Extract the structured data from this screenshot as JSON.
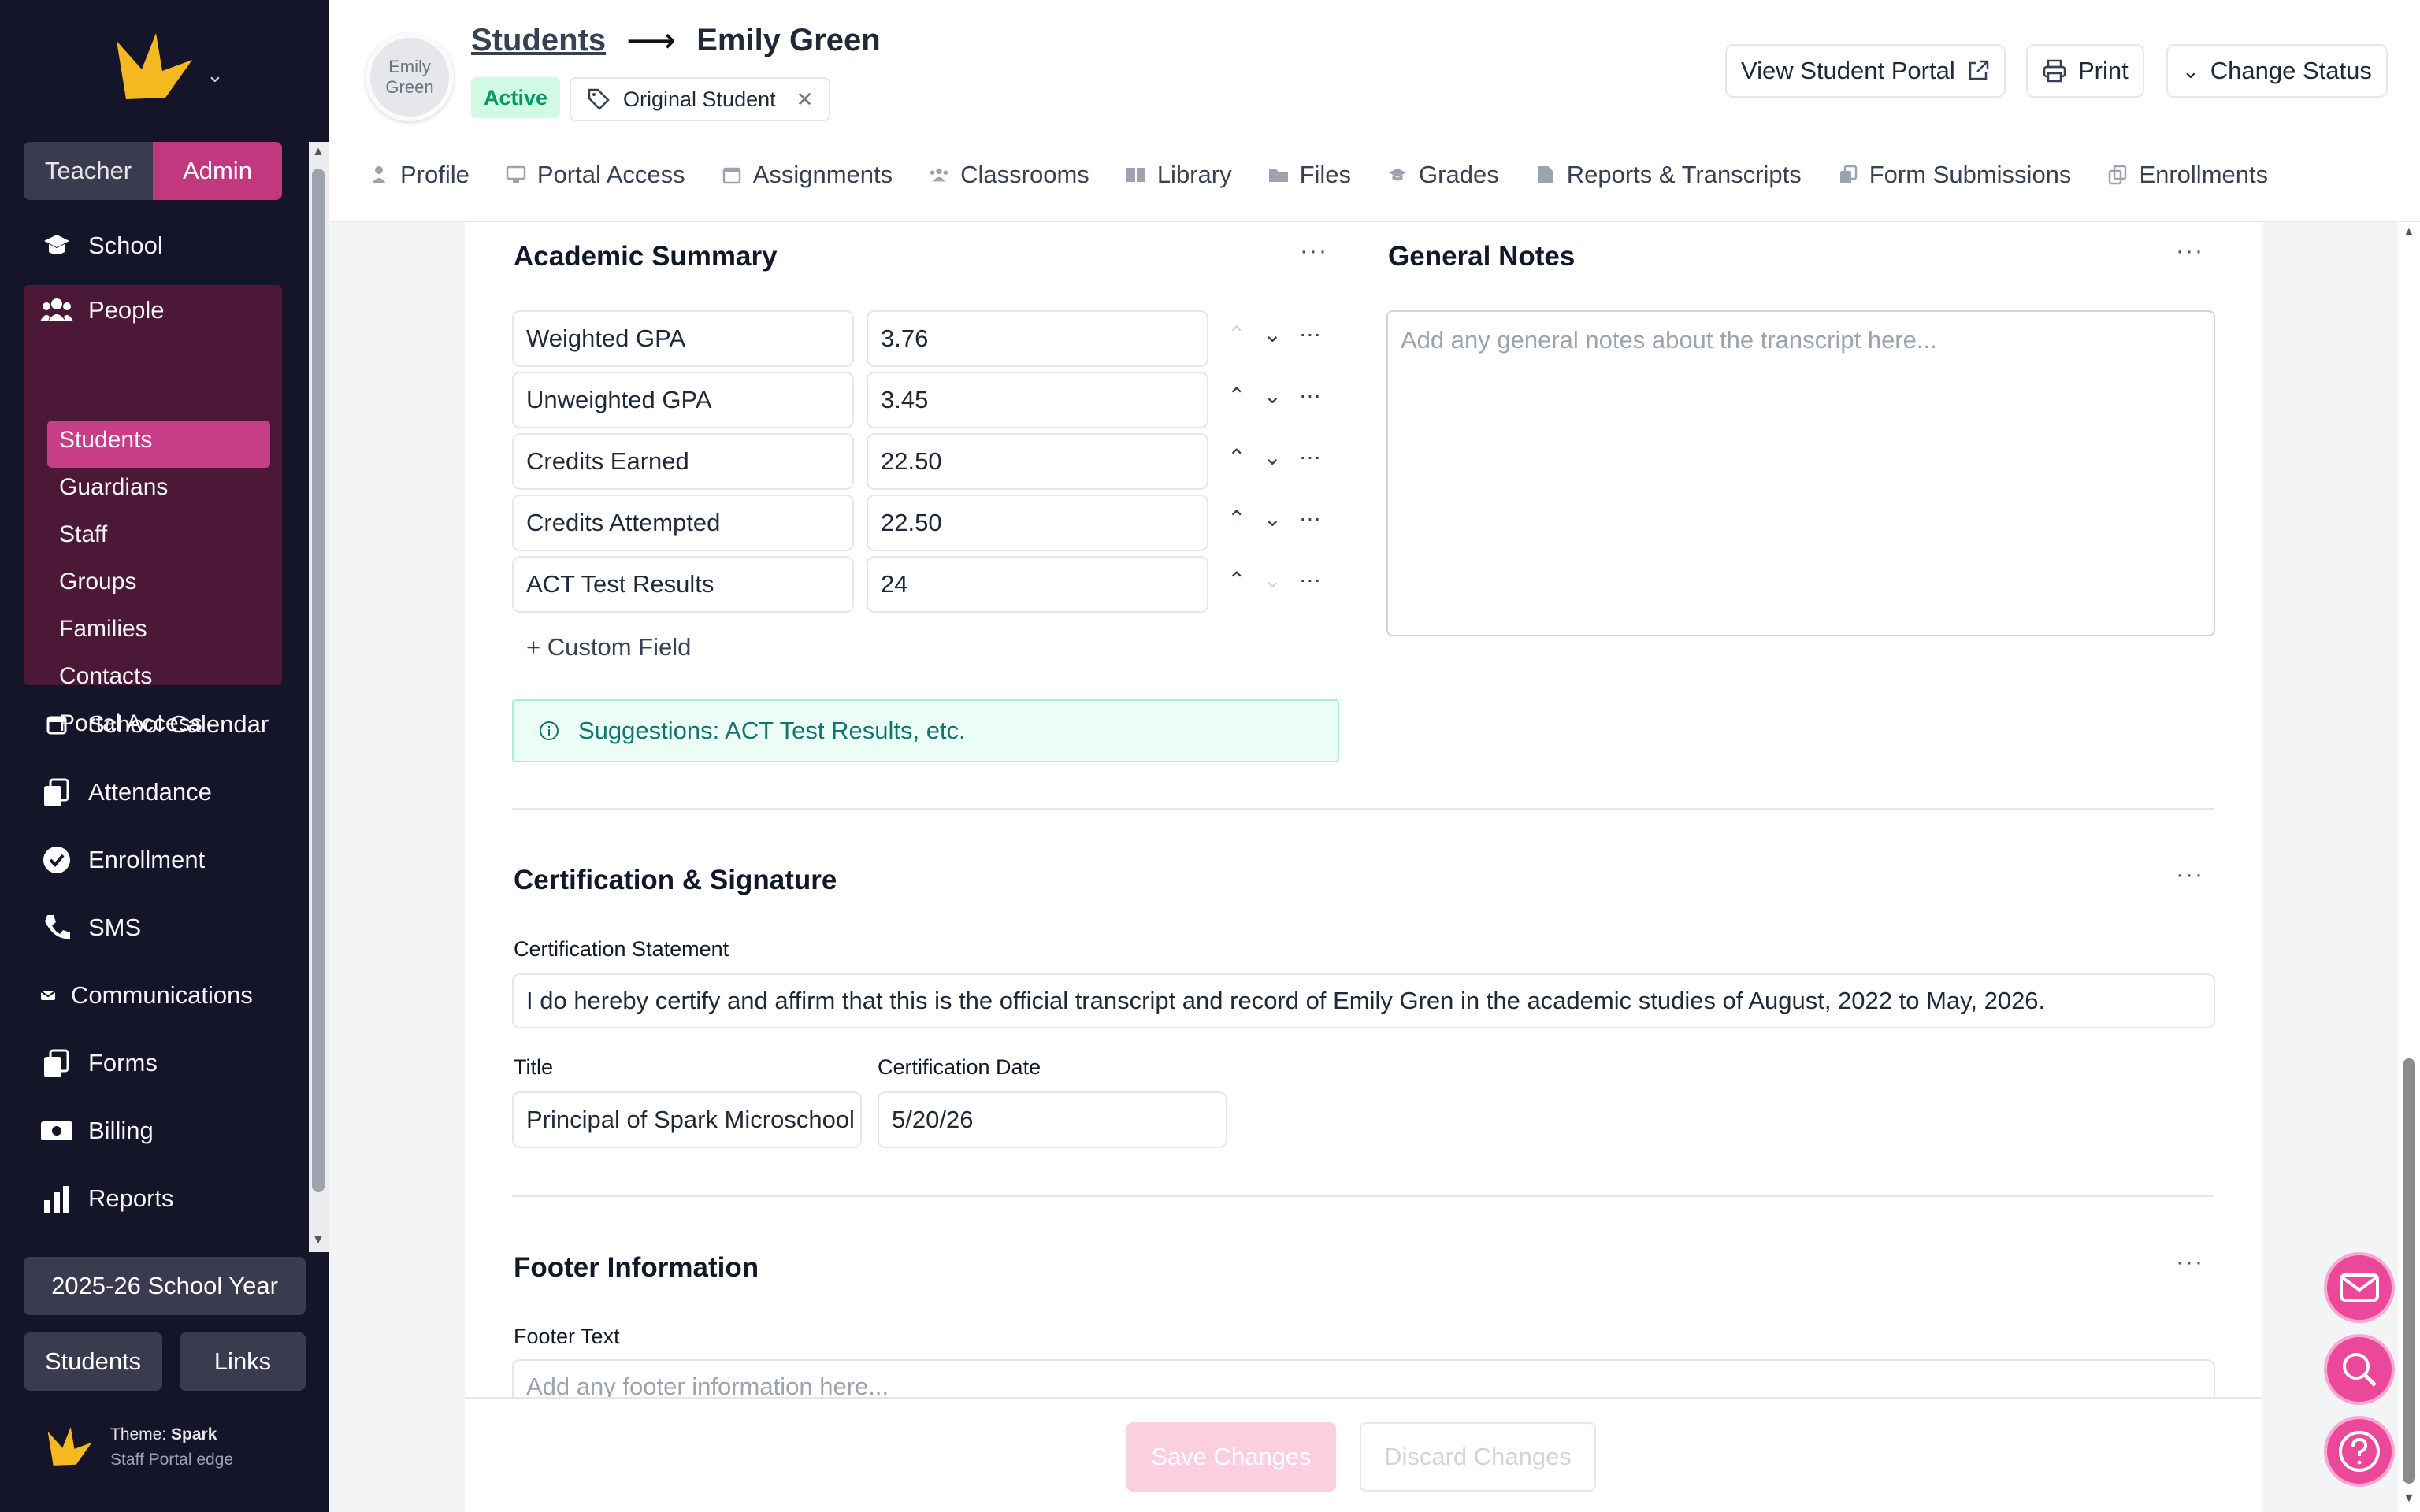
{
  "sidebar": {
    "roles": {
      "teacher": "Teacher",
      "admin": "Admin"
    },
    "nav": [
      {
        "label": "School",
        "icon": "school-icon"
      },
      {
        "label": "People",
        "icon": "people-icon"
      },
      {
        "label": "School Calendar",
        "icon": "calendar-icon"
      },
      {
        "label": "Attendance",
        "icon": "attendance-icon"
      },
      {
        "label": "Enrollment",
        "icon": "enrollment-icon"
      },
      {
        "label": "SMS",
        "icon": "phone-icon"
      },
      {
        "label": "Communications",
        "icon": "mail-icon"
      },
      {
        "label": "Forms",
        "icon": "forms-icon"
      },
      {
        "label": "Billing",
        "icon": "billing-icon"
      },
      {
        "label": "Reports",
        "icon": "reports-icon"
      }
    ],
    "people_sub": [
      "Students",
      "Guardians",
      "Staff",
      "Groups",
      "Families",
      "Contacts",
      "Portal Access"
    ],
    "school_year": "2025-26 School Year",
    "bottom_buttons": {
      "students": "Students",
      "links": "Links"
    },
    "theme": {
      "label": "Theme:",
      "name": "Spark",
      "sub": "Staff Portal edge"
    }
  },
  "header": {
    "avatar_text": "Emily Green",
    "breadcrumb": {
      "parent": "Students",
      "current": "Emily Green"
    },
    "status_badge": "Active",
    "tag": "Original Student",
    "buttons": {
      "portal": "View Student Portal",
      "print": "Print",
      "status": "Change Status"
    },
    "tabs": [
      "Profile",
      "Portal Access",
      "Assignments",
      "Classrooms",
      "Library",
      "Files",
      "Grades",
      "Reports & Transcripts",
      "Form Submissions",
      "Enrollments"
    ]
  },
  "academic": {
    "title": "Academic Summary",
    "rows": [
      {
        "label": "Weighted GPA",
        "value": "3.76"
      },
      {
        "label": "Unweighted GPA",
        "value": "3.45"
      },
      {
        "label": "Credits Earned",
        "value": "22.50"
      },
      {
        "label": "Credits Attempted",
        "value": "22.50"
      },
      {
        "label": "ACT Test Results",
        "value": "24"
      }
    ],
    "custom_field": "+ Custom Field",
    "suggestion": "Suggestions: ACT Test Results, etc."
  },
  "notes": {
    "title": "General Notes",
    "placeholder": "Add any general notes about the transcript here..."
  },
  "certification": {
    "title": "Certification & Signature",
    "statement_label": "Certification Statement",
    "statement": "I do hereby certify and affirm that this is the official transcript and record of Emily Gren in the academic studies of August, 2022 to May, 2026.",
    "title_label": "Title",
    "title_value": "Principal of Spark Microschool",
    "date_label": "Certification Date",
    "date_value": "5/20/26"
  },
  "footer_info": {
    "title": "Footer Information",
    "text_label": "Footer Text",
    "placeholder": "Add any footer information here..."
  },
  "actions": {
    "save": "Save Changes",
    "discard": "Discard Changes"
  },
  "colors": {
    "brand": "#c2387e",
    "sidebar_bg": "#15152a",
    "accent_pink": "#ec4899"
  }
}
